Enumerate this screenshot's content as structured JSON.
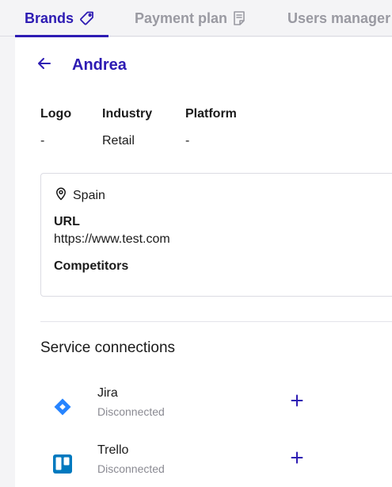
{
  "tabs": [
    {
      "label": "Brands",
      "icon": "tag-icon",
      "active": true
    },
    {
      "label": "Payment plan",
      "icon": "document-icon",
      "active": false
    },
    {
      "label": "Users manager",
      "icon": "",
      "active": false
    }
  ],
  "brand": {
    "name": "Andrea",
    "back_icon": "arrow-left-icon"
  },
  "info": {
    "logo": {
      "label": "Logo",
      "value": "-"
    },
    "industry": {
      "label": "Industry",
      "value": "Retail"
    },
    "platform": {
      "label": "Platform",
      "value": "-"
    }
  },
  "details": {
    "location": "Spain",
    "location_icon": "map-pin-icon",
    "url_label": "URL",
    "url_value": "https://www.test.com",
    "competitors_label": "Competitors"
  },
  "service_connections": {
    "title": "Service connections",
    "items": [
      {
        "name": "Jira",
        "status": "Disconnected",
        "icon": "jira-icon",
        "color": "#2684ff"
      },
      {
        "name": "Trello",
        "status": "Disconnected",
        "icon": "trello-icon",
        "color": "#0079bf"
      }
    ]
  },
  "colors": {
    "accent": "#2d1bb3",
    "muted_text": "#9a9aa2",
    "status_text": "#8a8a92"
  }
}
